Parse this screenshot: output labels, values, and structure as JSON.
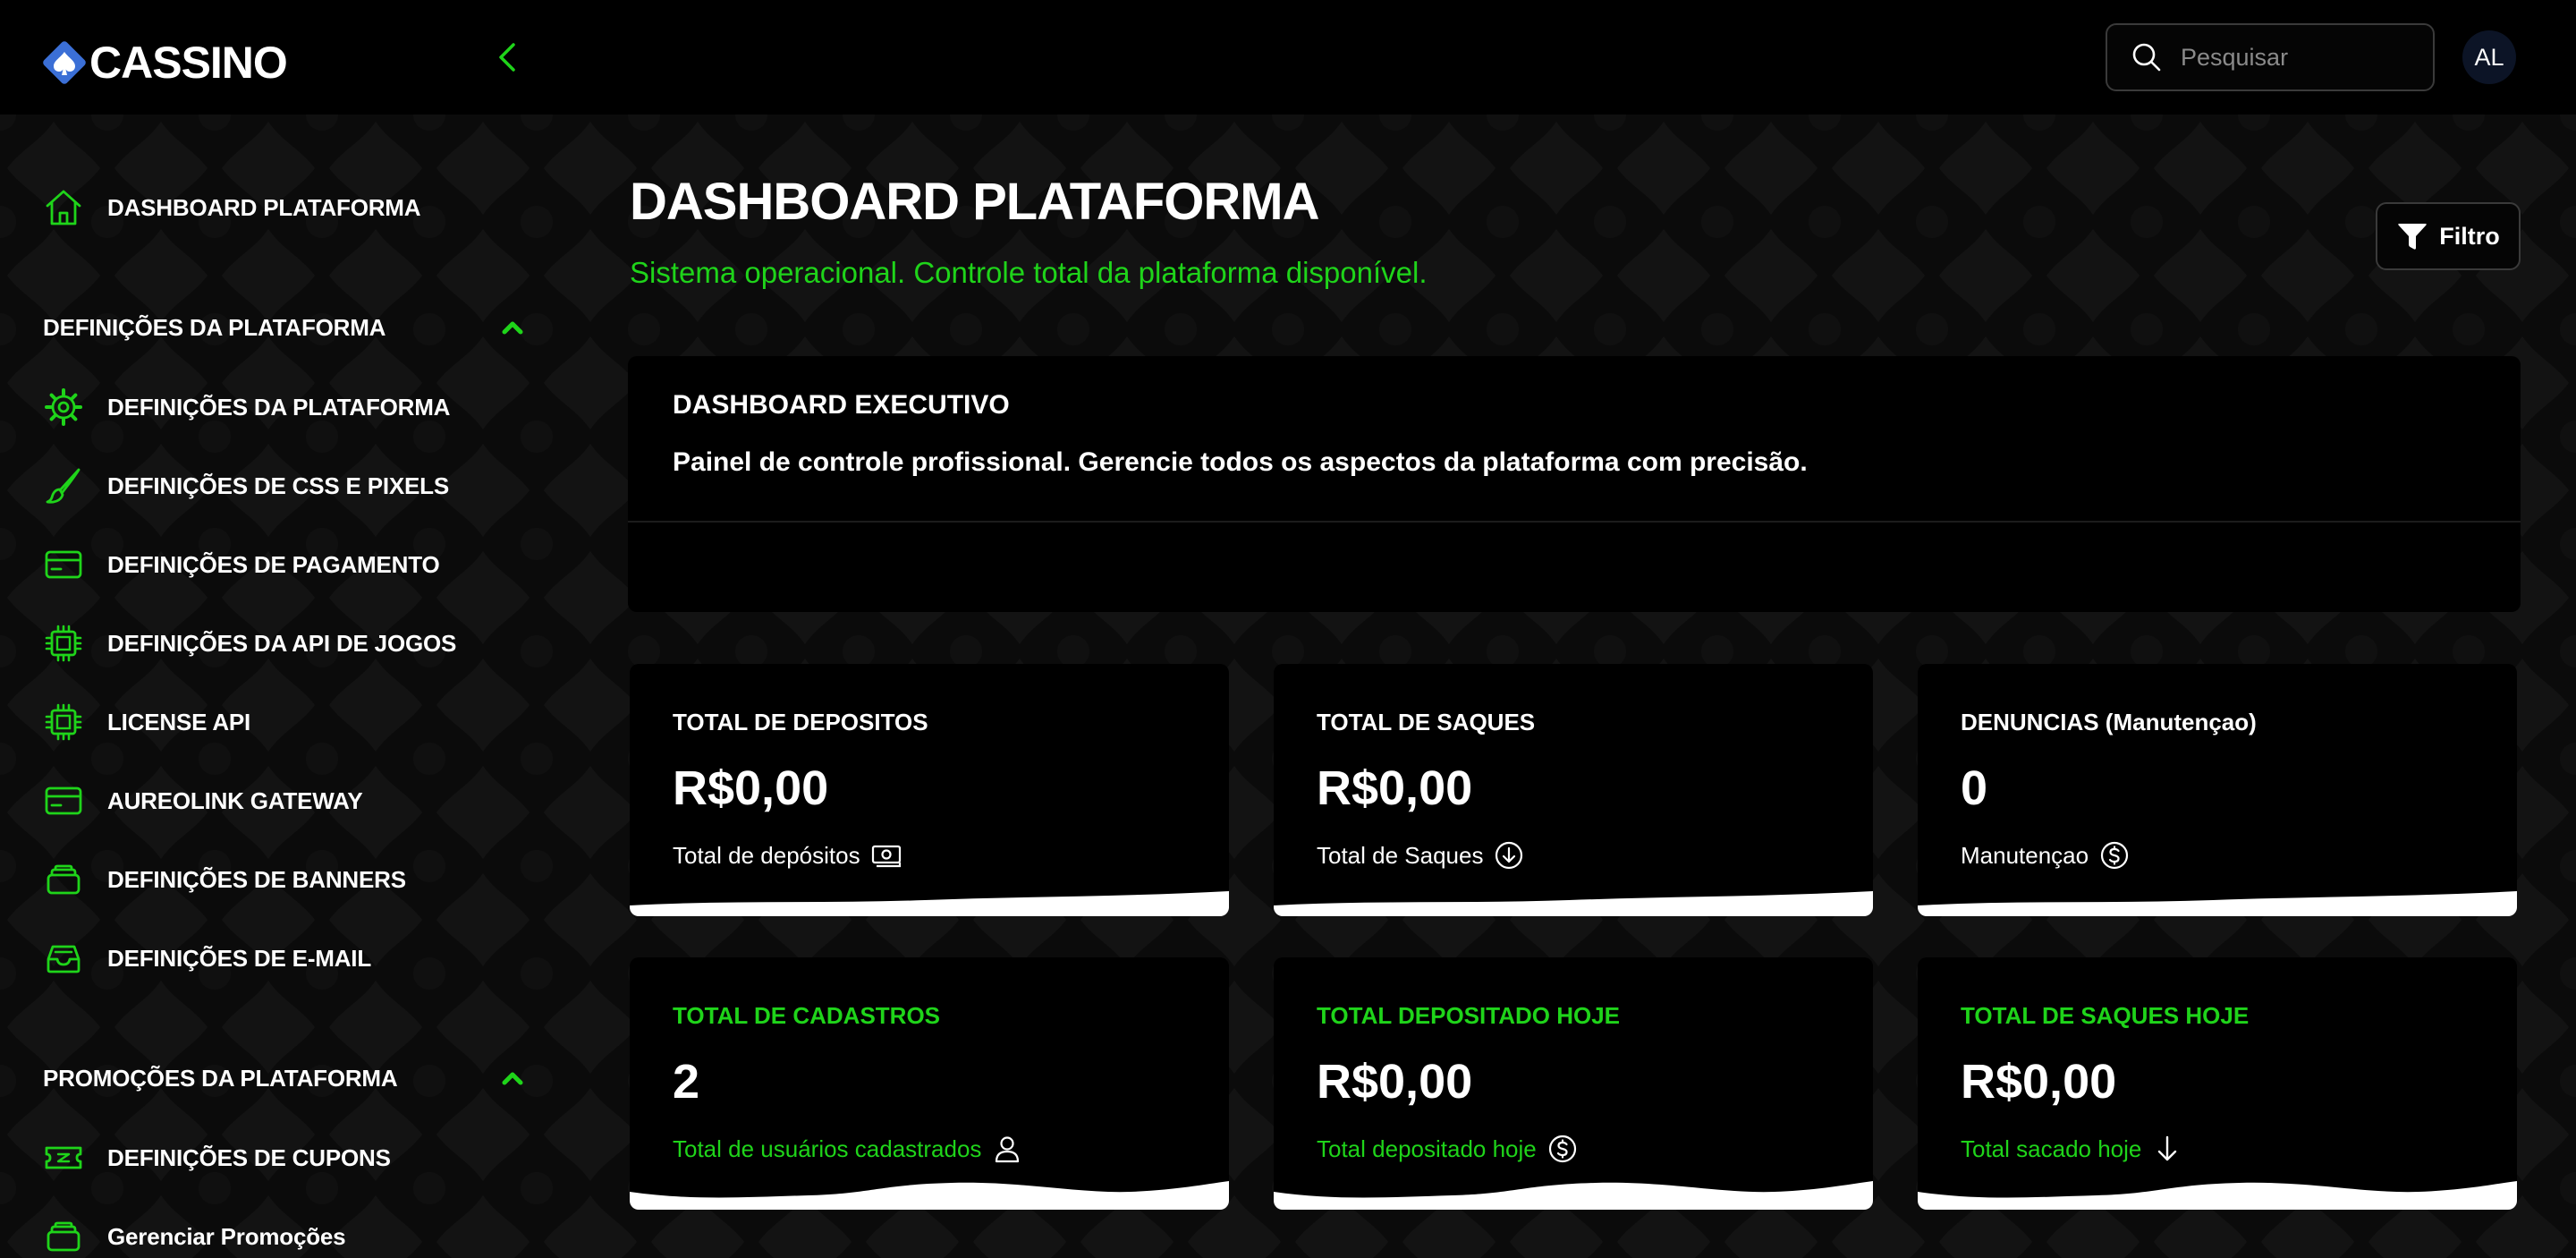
{
  "header": {
    "logo_text": "CASSINO",
    "search_placeholder": "Pesquisar",
    "avatar_initials": "AL"
  },
  "sidebar": {
    "dashboard": "DASHBOARD PLATAFORMA",
    "sections": [
      {
        "title": "DEFINIÇÕES DA PLATAFORMA",
        "items": [
          {
            "label": "DEFINIÇÕES DA PLATAFORMA",
            "icon": "gear-icon"
          },
          {
            "label": "DEFINIÇÕES DE CSS E PIXELS",
            "icon": "brush-icon"
          },
          {
            "label": "DEFINIÇÕES DE PAGAMENTO",
            "icon": "credit-card-icon"
          },
          {
            "label": "DEFINIÇÕES DA API DE JOGOS",
            "icon": "chip-icon"
          },
          {
            "label": "LICENSE API",
            "icon": "chip-icon"
          },
          {
            "label": "AUREOLINK GATEWAY",
            "icon": "credit-card-icon"
          },
          {
            "label": "DEFINIÇÕES DE BANNERS",
            "icon": "stack-icon"
          },
          {
            "label": "DEFINIÇÕES DE E-MAIL",
            "icon": "inbox-icon"
          }
        ]
      },
      {
        "title": "PROMOÇÕES DA PLATAFORMA",
        "items": [
          {
            "label": "DEFINIÇÕES DE CUPONS",
            "icon": "ticket-icon"
          },
          {
            "label": "Gerenciar Promoções",
            "icon": "stack-icon"
          }
        ]
      }
    ]
  },
  "main": {
    "title": "DASHBOARD PLATAFORMA",
    "subtitle": "Sistema operacional. Controle total da plataforma disponível.",
    "filter_label": "Filtro",
    "exec": {
      "title": "DASHBOARD EXECUTIVO",
      "description": "Painel de controle profissional. Gerencie todos os aspectos da plataforma com precisão."
    },
    "stats": [
      {
        "title": "TOTAL DE DEPOSITOS",
        "value": "R$0,00",
        "desc": "Total de depósitos",
        "icon": "cash-icon"
      },
      {
        "title": "TOTAL DE SAQUES",
        "value": "R$0,00",
        "desc": "Total de Saques",
        "icon": "arrow-down-circle-icon"
      },
      {
        "title": "DENUNCIAS (Manutençao)",
        "value": "0",
        "desc": "Manutençao",
        "icon": "dollar-circle-icon"
      },
      {
        "title": "TOTAL DE CADASTROS",
        "value": "2",
        "desc": "Total de usuários cadastrados",
        "icon": "user-icon"
      },
      {
        "title": "TOTAL DEPOSITADO HOJE",
        "value": "R$0,00",
        "desc": "Total depositado hoje",
        "icon": "dollar-circle-icon"
      },
      {
        "title": "TOTAL DE SAQUES HOJE",
        "value": "R$0,00",
        "desc": "Total sacado hoje",
        "icon": "arrow-down-icon"
      }
    ]
  },
  "colors": {
    "accent_green": "#1fd41a",
    "background": "#000000",
    "card_border": "#3a3a3a"
  }
}
